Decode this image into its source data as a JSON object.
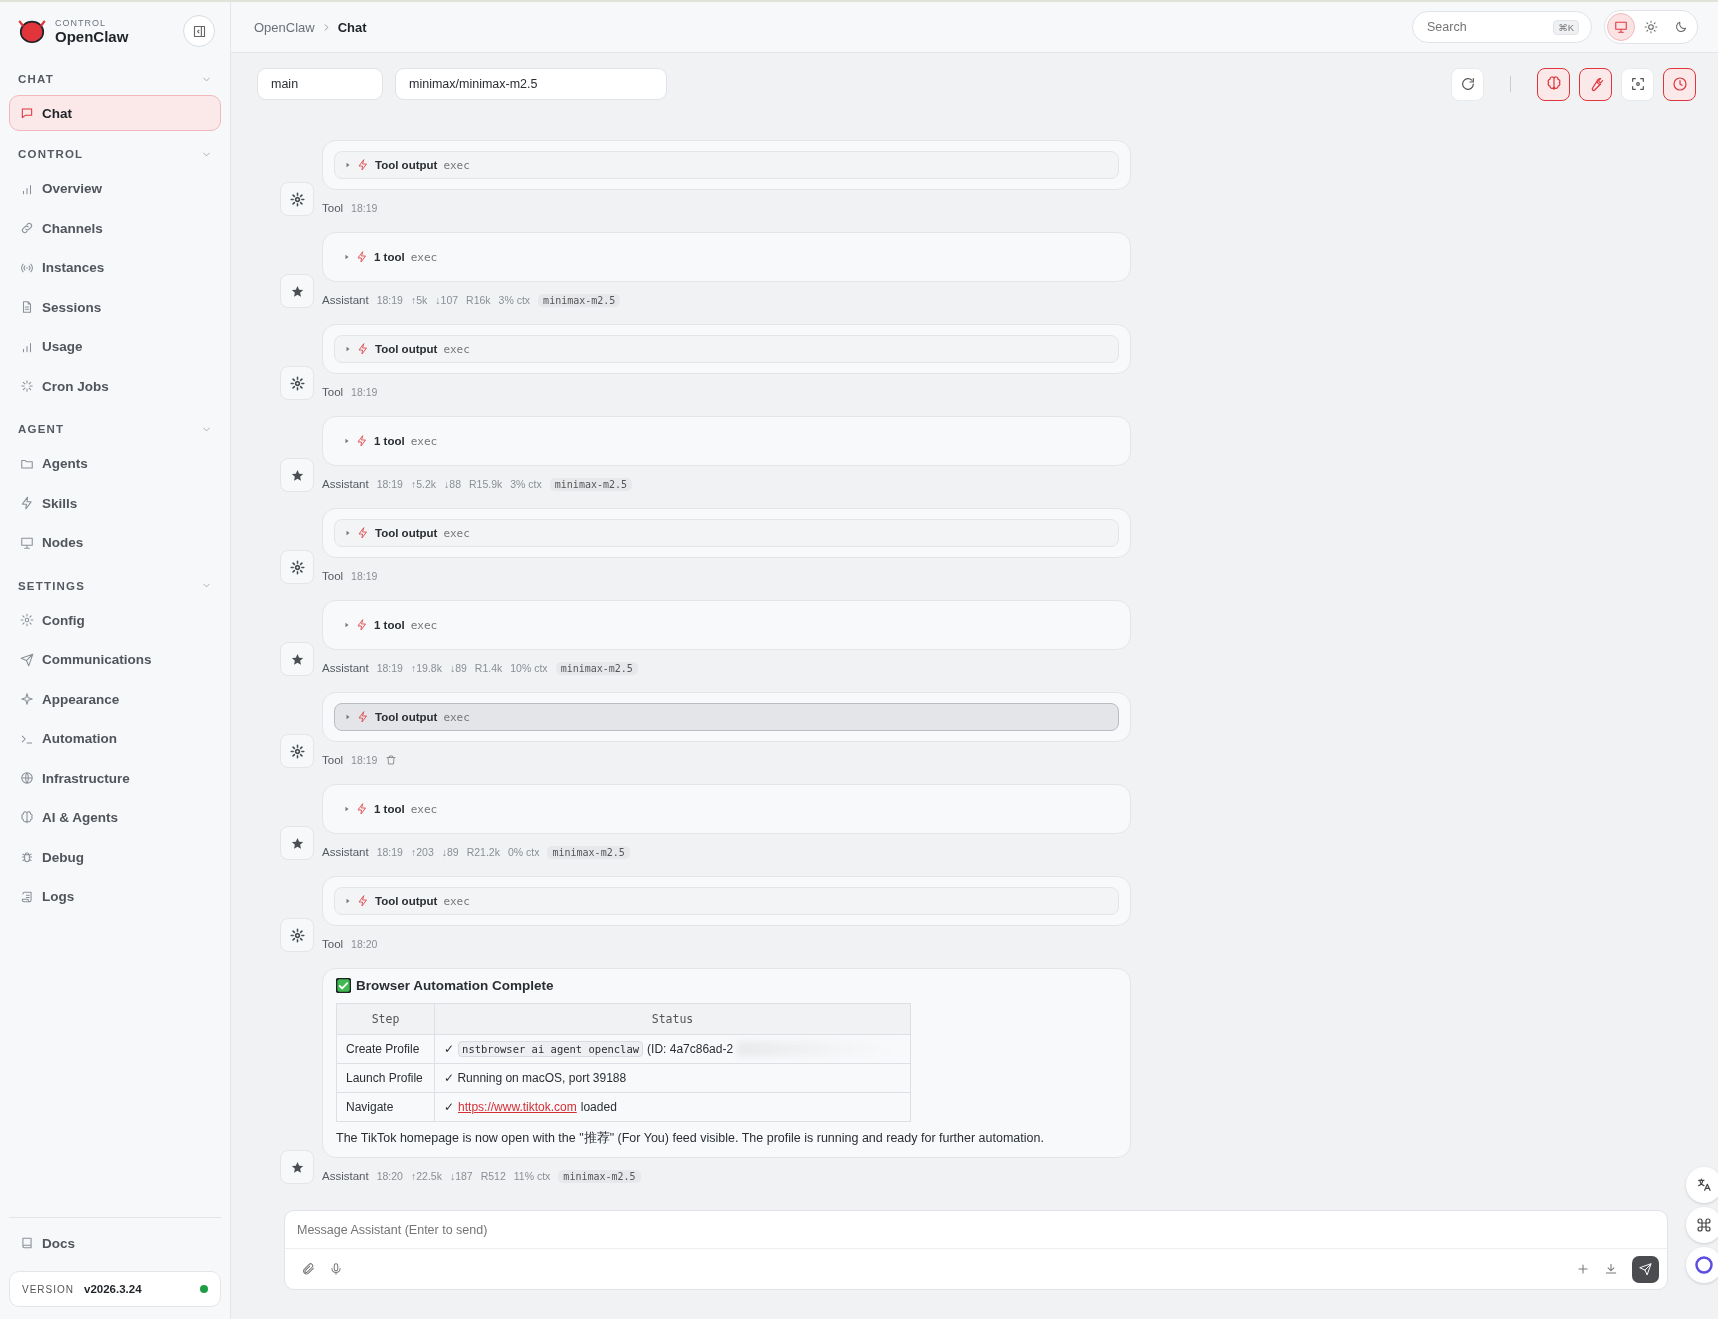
{
  "brand": {
    "eyebrow": "CONTROL",
    "name": "OpenClaw"
  },
  "sidebar": {
    "sections": [
      {
        "title": "CHAT",
        "items": [
          {
            "label": "Chat",
            "selected": true
          }
        ]
      },
      {
        "title": "CONTROL",
        "items": [
          {
            "label": "Overview",
            "selected": false
          },
          {
            "label": "Channels",
            "selected": false
          },
          {
            "label": "Instances",
            "selected": false
          },
          {
            "label": "Sessions",
            "selected": false
          },
          {
            "label": "Usage",
            "selected": false
          },
          {
            "label": "Cron Jobs",
            "selected": false
          }
        ]
      },
      {
        "title": "AGENT",
        "items": [
          {
            "label": "Agents",
            "selected": false
          },
          {
            "label": "Skills",
            "selected": false
          },
          {
            "label": "Nodes",
            "selected": false
          }
        ]
      },
      {
        "title": "SETTINGS",
        "items": [
          {
            "label": "Config",
            "selected": false
          },
          {
            "label": "Communications",
            "selected": false
          },
          {
            "label": "Appearance",
            "selected": false
          },
          {
            "label": "Automation",
            "selected": false
          },
          {
            "label": "Infrastructure",
            "selected": false
          },
          {
            "label": "AI & Agents",
            "selected": false
          },
          {
            "label": "Debug",
            "selected": false
          },
          {
            "label": "Logs",
            "selected": false
          }
        ]
      }
    ],
    "footer_item": {
      "label": "Docs"
    },
    "version": {
      "label": "VERSION",
      "value": "v2026.3.24",
      "online": true
    }
  },
  "breadcrumb": [
    "OpenClaw",
    "Chat"
  ],
  "search": {
    "placeholder": "Search",
    "shortcut": "⌘K"
  },
  "theme_options": [
    {
      "kind": "monitor",
      "selected": true
    },
    {
      "kind": "sun",
      "selected": false
    },
    {
      "kind": "moon",
      "selected": false
    }
  ],
  "session_field": {
    "value": "main"
  },
  "model_field": {
    "value": "minimax/minimax-m2.5"
  },
  "toolbar_buttons": [
    {
      "kind": "refresh",
      "on": false
    },
    {
      "kind": "brain",
      "on": true
    },
    {
      "kind": "wrench",
      "on": true
    },
    {
      "kind": "focus",
      "on": false
    },
    {
      "kind": "clock",
      "on": true
    }
  ],
  "messages": [
    {
      "kind": "tool",
      "title": "Tool output",
      "detail": "exec",
      "sender": "Tool",
      "time": "18:19",
      "hovered": false
    },
    {
      "kind": "assistant",
      "title": "1 tool",
      "detail": "exec",
      "sender": "Assistant",
      "time": "18:19",
      "stats": [
        "↑5k",
        "↓107",
        "R16k",
        "3% ctx"
      ],
      "model": "minimax-m2.5"
    },
    {
      "kind": "tool",
      "title": "Tool output",
      "detail": "exec",
      "sender": "Tool",
      "time": "18:19",
      "hovered": false
    },
    {
      "kind": "assistant",
      "title": "1 tool",
      "detail": "exec",
      "sender": "Assistant",
      "time": "18:19",
      "stats": [
        "↑5.2k",
        "↓88",
        "R15.9k",
        "3% ctx"
      ],
      "model": "minimax-m2.5"
    },
    {
      "kind": "tool",
      "title": "Tool output",
      "detail": "exec",
      "sender": "Tool",
      "time": "18:19",
      "hovered": false
    },
    {
      "kind": "assistant",
      "title": "1 tool",
      "detail": "exec",
      "sender": "Assistant",
      "time": "18:19",
      "stats": [
        "↑19.8k",
        "↓89",
        "R1.4k",
        "10% ctx"
      ],
      "model": "minimax-m2.5"
    },
    {
      "kind": "tool",
      "title": "Tool output",
      "detail": "exec",
      "sender": "Tool",
      "time": "18:19",
      "hovered": true
    },
    {
      "kind": "assistant",
      "title": "1 tool",
      "detail": "exec",
      "sender": "Assistant",
      "time": "18:19",
      "stats": [
        "↑203",
        "↓89",
        "R21.2k",
        "0% ctx"
      ],
      "model": "minimax-m2.5"
    },
    {
      "kind": "tool",
      "title": "Tool output",
      "detail": "exec",
      "sender": "Tool",
      "time": "18:20",
      "hovered": false
    },
    {
      "kind": "report",
      "heading": "Browser Automation Complete",
      "columns": [
        "Step",
        "Status"
      ],
      "rows": [
        {
          "step": "Create Profile",
          "parts": [
            {
              "kind": "text",
              "text": "✓"
            },
            {
              "kind": "code",
              "text": "nstbrowser ai agent openclaw"
            },
            {
              "kind": "text",
              "text": "(ID: 4a7c86ad-2"
            }
          ],
          "blurred": true
        },
        {
          "step": "Launch Profile",
          "parts": [
            {
              "kind": "text",
              "text": "✓ Running on macOS, port 39188"
            }
          ],
          "blurred": false
        },
        {
          "step": "Navigate",
          "parts": [
            {
              "kind": "text",
              "text": "✓"
            },
            {
              "kind": "link",
              "text": "https://www.tiktok.com"
            },
            {
              "kind": "text",
              "text": "loaded"
            }
          ],
          "blurred": false
        }
      ],
      "paragraph": "The TikTok homepage is now open with the \"推荐\" (For You) feed visible. The profile is running and ready for further automation.",
      "sender": "Assistant",
      "time": "18:20",
      "stats": [
        "↑22.5k",
        "↓187",
        "R512",
        "11% ctx"
      ],
      "model": "minimax-m2.5"
    }
  ],
  "composer": {
    "placeholder": "Message Assistant (Enter to send)"
  },
  "floating_buttons": [
    {
      "kind": "translate"
    },
    {
      "kind": "command"
    },
    {
      "kind": "ring"
    }
  ]
}
